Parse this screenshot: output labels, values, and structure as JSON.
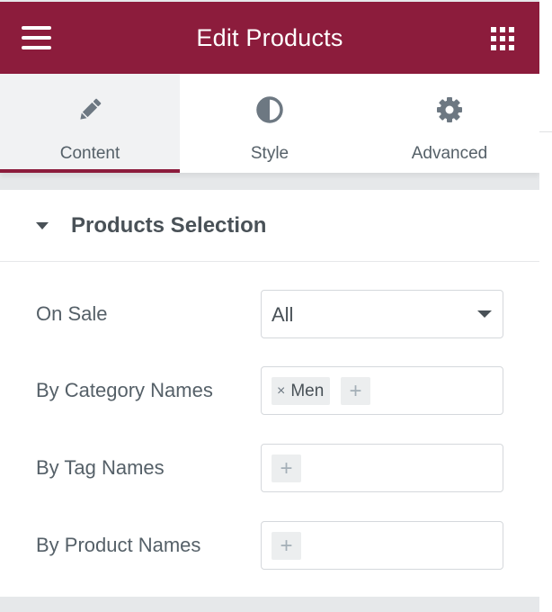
{
  "header": {
    "title": "Edit Products",
    "menu_icon": "hamburger-icon",
    "apps_icon": "grid-icon",
    "color": "#8c1c3c"
  },
  "tabs": [
    {
      "label": "Content",
      "icon": "pencil-icon",
      "active": true
    },
    {
      "label": "Style",
      "icon": "half-circle-icon",
      "active": false
    },
    {
      "label": "Advanced",
      "icon": "gear-icon",
      "active": false
    }
  ],
  "section": {
    "title": "Products Selection",
    "fields": [
      {
        "label": "On Sale",
        "type": "select",
        "value": "All"
      },
      {
        "label": "By Category Names",
        "type": "tags",
        "tags": [
          "Men"
        ]
      },
      {
        "label": "By Tag Names",
        "type": "tags",
        "tags": []
      },
      {
        "label": "By Product Names",
        "type": "tags",
        "tags": []
      }
    ],
    "remove_symbol": "×",
    "add_symbol": "+"
  }
}
